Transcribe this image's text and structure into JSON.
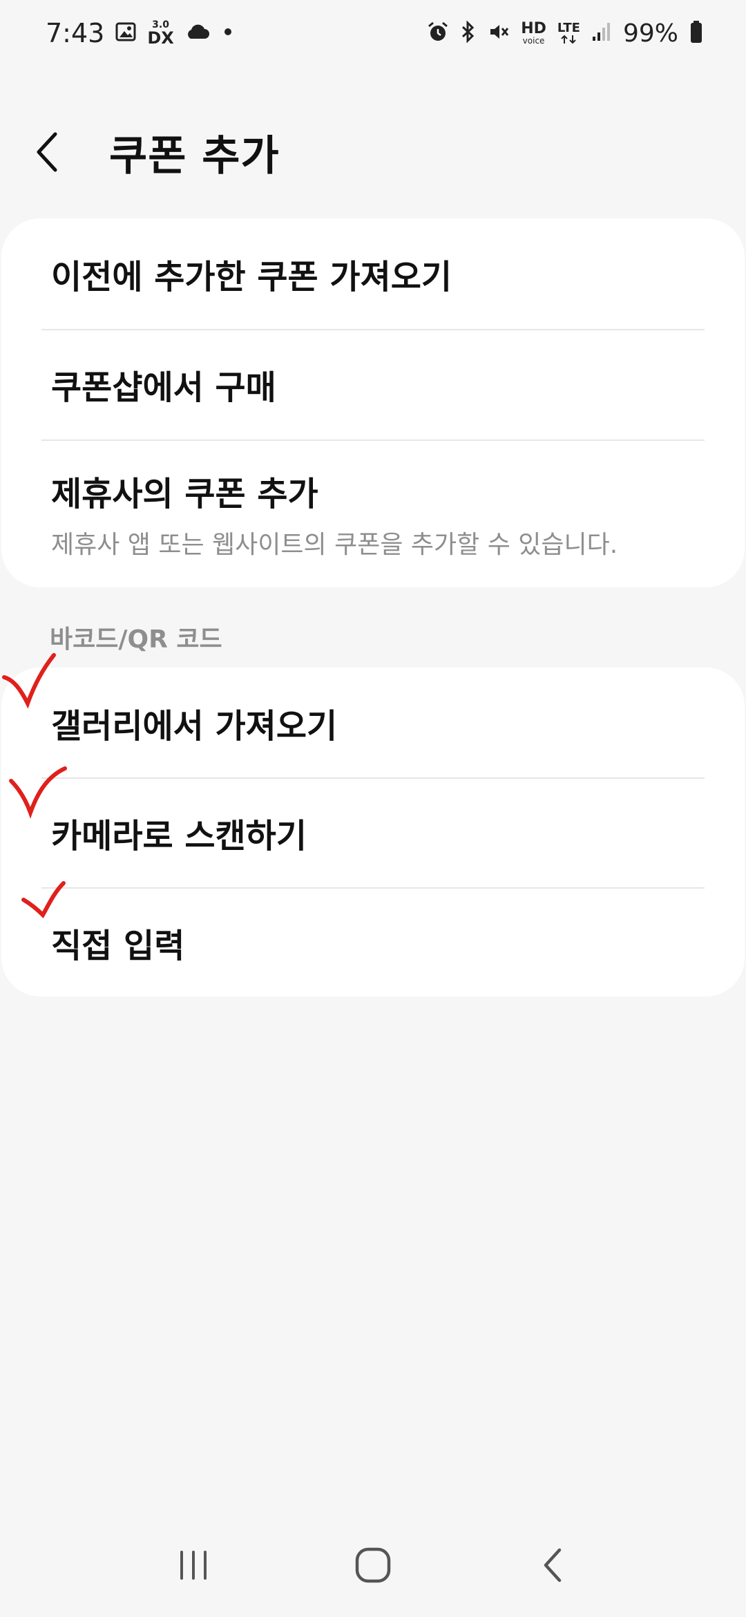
{
  "status_bar": {
    "time": "7:43",
    "dex_label_top": "3.0",
    "dex_label": "DX",
    "hd_label": "HD",
    "voice_label": "voice",
    "lte_label": "LTE",
    "battery": "99%",
    "icons": [
      "gallery-icon",
      "dex-icon",
      "cloud-icon",
      "dot-icon",
      "alarm-icon",
      "bluetooth-icon",
      "mute-icon",
      "hd-voice-icon",
      "lte-icon",
      "signal-icon",
      "battery-icon"
    ]
  },
  "header": {
    "title": "쿠폰 추가"
  },
  "card_top": {
    "items": [
      {
        "title": "이전에 추가한 쿠폰 가져오기"
      },
      {
        "title": "쿠폰샵에서 구매"
      },
      {
        "title": "제휴사의 쿠폰 추가",
        "subtitle": "제휴사 앱 또는 웹사이트의 쿠폰을 추가할 수 있습니다."
      }
    ]
  },
  "section": {
    "label": "바코드/QR 코드"
  },
  "card_barcode": {
    "items": [
      {
        "title": "갤러리에서 가져오기"
      },
      {
        "title": "카메라로 스캔하기"
      },
      {
        "title": "직접 입력"
      }
    ]
  },
  "annotation": {
    "mark_color": "#e0201c"
  },
  "colors": {
    "background": "#f6f6f6",
    "card": "#ffffff",
    "secondary_text": "#8e8e8e"
  }
}
